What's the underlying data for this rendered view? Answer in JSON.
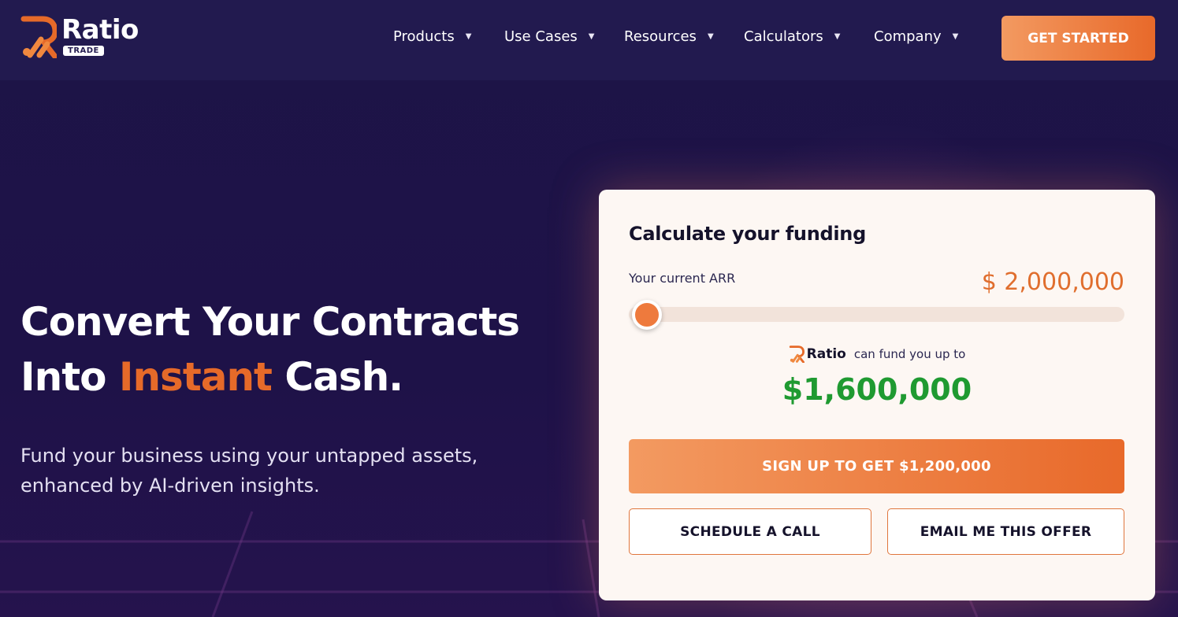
{
  "brand": {
    "name": "Ratio",
    "badge": "TRADE",
    "colors": {
      "accent": "#e66a29",
      "navy": "#1c1243",
      "green": "#1f9a31"
    }
  },
  "nav": {
    "items": [
      {
        "label": "Products",
        "icon": "chevron-down-icon"
      },
      {
        "label": "Use Cases",
        "icon": "chevron-down-icon"
      },
      {
        "label": "Resources",
        "icon": "chevron-down-icon"
      },
      {
        "label": "Calculators",
        "icon": "chevron-down-icon"
      },
      {
        "label": "Company",
        "icon": "chevron-down-icon"
      }
    ],
    "cta_label": "GET STARTED"
  },
  "hero": {
    "title_line1": "Convert Your Contracts",
    "title_line2_start": "Into ",
    "title_accent": "Instant",
    "title_line2_end": " Cash.",
    "subtitle": "Fund your business using your untapped assets, enhanced by AI-driven insights."
  },
  "calculator": {
    "title": "Calculate your funding",
    "arr_label": "Your current ARR",
    "arr_value": "$ 2,000,000",
    "slider_level": 0.0,
    "fund_brand": "Ratio",
    "fund_text": "can fund you up to",
    "fund_amount": "$1,600,000",
    "signup_label": "SIGN UP TO GET $1,200,000",
    "schedule_label": "SCHEDULE A CALL",
    "email_label": "EMAIL ME THIS OFFER"
  }
}
